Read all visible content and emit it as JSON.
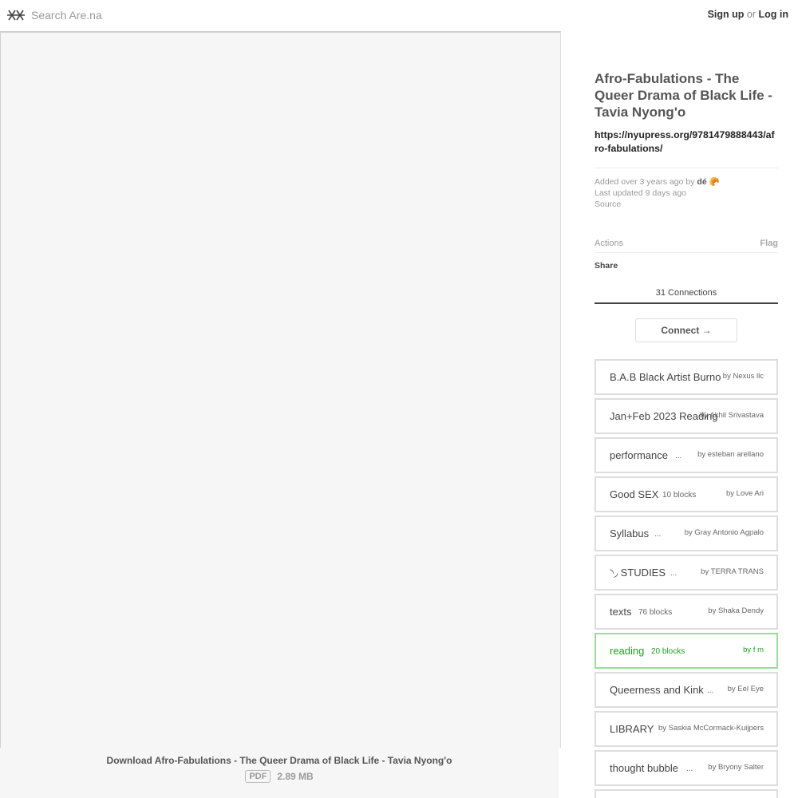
{
  "header": {
    "logo_icon": "arena-logo-icon",
    "search_placeholder": "Search Are.na",
    "signup": "Sign up",
    "or": "or",
    "login": "Log in"
  },
  "viewer": {
    "download_label": "Download Afro-Fabulations - The Queer Drama of Black Life - Tavia Nyong'o",
    "file_type": "PDF",
    "file_size": "2.89 MB"
  },
  "block": {
    "title": "Afro-Fabulations - The Queer Drama of Black Life - Tavia Nyong'o",
    "url": "https://nyupress.org/9781479888443/afro-fabulations/",
    "added": "Added over 3 years ago by",
    "author": "dé",
    "author_emoji": "🥐",
    "updated": "Last updated 9 days ago",
    "source": "Source"
  },
  "actions": {
    "label": "Actions",
    "flag": "Flag",
    "share": "Share"
  },
  "connections": {
    "tab_label": "31 Connections",
    "connect_button": "Connect →",
    "items": [
      {
        "name": "B.A.B Black Artist Burnout",
        "blocks": "",
        "by": "by Nexus llc",
        "green": false
      },
      {
        "name": "Jan+Feb 2023 Reading",
        "blocks": "",
        "by": "by Akhil Srivastava",
        "green": false
      },
      {
        "name": "performance",
        "blocks": "...",
        "by": "by esteban arellano",
        "green": false
      },
      {
        "name": "Good SEX",
        "blocks": "10 blocks",
        "by": "by Love Ari",
        "green": false
      },
      {
        "name": "Syllabus",
        "blocks": "...",
        "by": "by Gray Antonio Agpalo",
        "green": false
      },
      {
        "name": "◝◞ STUDIES",
        "blocks": "...",
        "by": "by TERRA TRANS",
        "green": false
      },
      {
        "name": "texts",
        "blocks": "76 blocks",
        "by": "by Shaka Dendy",
        "green": false
      },
      {
        "name": "reading",
        "blocks": "20 blocks",
        "by": "by f m",
        "green": true
      },
      {
        "name": "Queerness and Kink",
        "blocks": "...",
        "by": "by Eel Eye",
        "green": false
      },
      {
        "name": "LIBRARY",
        "blocks": "",
        "by": "by Saskia McCormack-Kuijpers",
        "green": false
      },
      {
        "name": "thought bubble",
        "blocks": "...",
        "by": "by Bryony Salter",
        "green": false
      },
      {
        "name": "",
        "blocks": "",
        "by": "",
        "green": false
      }
    ]
  }
}
